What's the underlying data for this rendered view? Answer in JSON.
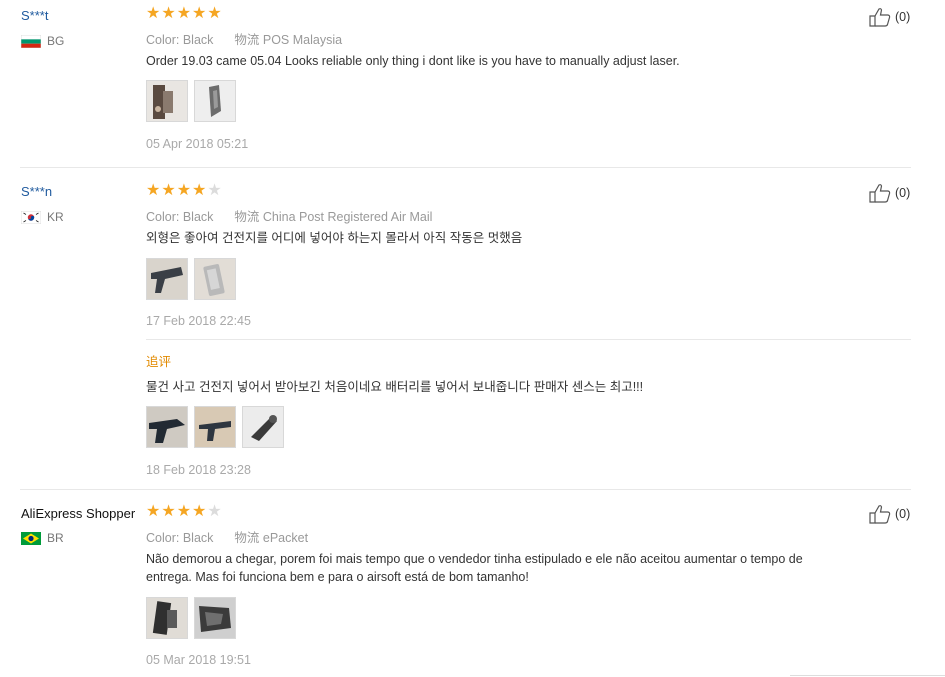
{
  "labels": {
    "color": "Color:",
    "shipping": "物流",
    "followup": "追评"
  },
  "reviews": [
    {
      "user": "S***t",
      "country": "BG",
      "rating": 5,
      "color": "Black",
      "shipping": "POS Malaysia",
      "text": "Order 19.03 came 05.04 Looks reliable only thing i dont like is you have to manually adjust laser.",
      "photo_count": 2,
      "date": "05 Apr 2018 05:21",
      "helpful": "(0)"
    },
    {
      "user": "S***n",
      "country": "KR",
      "rating": 4,
      "color": "Black",
      "shipping": "China Post Registered Air Mail",
      "text": "외형은 좋아여 건전지를 어디에 넣어야 하는지 몰라서 아직 작동은 멋했음",
      "photo_count": 2,
      "date": "17 Feb 2018 22:45",
      "helpful": "(0)",
      "followup": {
        "text": "물건 사고 건전지 넣어서 받아보긴 처음이네요 배터리를 넣어서 보내줍니다 판매자 센스는 최고!!!",
        "photo_count": 3,
        "date": "18 Feb 2018 23:28"
      }
    },
    {
      "user": "AliExpress Shopper",
      "country": "BR",
      "rating": 4,
      "color": "Black",
      "shipping": "ePacket",
      "text_line1": "Não demorou a chegar, porem foi mais tempo que o vendedor tinha estipulado e ele não aceitou aumentar o tempo de",
      "text_line2": "entrega. Mas foi funciona bem e para o airsoft está de bom tamanho!",
      "photo_count": 2,
      "date": "05 Mar 2018 19:51",
      "helpful": "(0)"
    }
  ],
  "colors": {
    "star_on": "#f5a623",
    "star_off": "#dcdcdc",
    "user_link": "#1f5a9e",
    "followup": "#e28a00"
  }
}
